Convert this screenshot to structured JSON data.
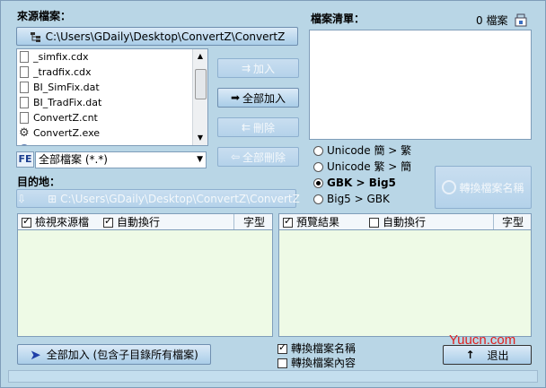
{
  "source": {
    "label": "來源檔案：",
    "path": "C:\\Users\\GDaily\\Desktop\\ConvertZ\\ConvertZ",
    "files": [
      "_simfix.cdx",
      "_tradfix.cdx",
      "BI_SimFix.dat",
      "BI_TradFix.dat",
      "ConvertZ.cnt",
      "ConvertZ.exe"
    ],
    "filter_badge": "FE",
    "filter": "全部檔案 (*.*)"
  },
  "list": {
    "label": "檔案清單：",
    "count": "0 檔案"
  },
  "buttons": {
    "add": "加入",
    "add_all": "全部加入",
    "delete": "刪除",
    "delete_all": "全部刪除",
    "convert_names": "轉換檔案名稱",
    "add_all_sub": "全部加入 (包含子目錄所有檔案)",
    "exit": "退出"
  },
  "conversion": {
    "options": [
      "Unicode 簡 > 繁",
      "Unicode 繁 > 簡",
      "GBK > Big5",
      "Big5 > GBK"
    ],
    "selected_index": 2
  },
  "dest": {
    "label": "目的地：",
    "path": "C:\\Users\\GDaily\\Desktop\\ConvertZ\\ConvertZ"
  },
  "left_panel": {
    "view_source": "檢視來源檔",
    "wrap": "自動換行",
    "font": "字型"
  },
  "right_panel": {
    "preview": "預覽結果",
    "wrap": "自動換行",
    "font": "字型"
  },
  "bottom_options": {
    "convert_names": "轉換檔案名稱",
    "convert_content": "轉換檔案內容"
  },
  "watermark": "Yuucn.com"
}
